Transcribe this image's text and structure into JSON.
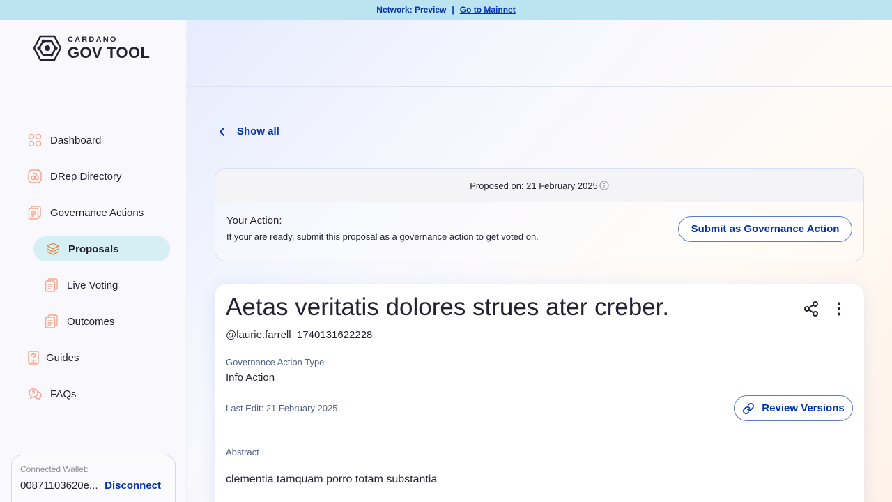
{
  "banner": {
    "network_text": "Network: Preview",
    "separator": "|",
    "mainnet_link": "Go to Mainnet"
  },
  "logo": {
    "small_text": "CARDANO",
    "big_text": "GOV TOOL"
  },
  "sidebar": {
    "items": [
      {
        "label": "Dashboard",
        "icon": "dashboard-icon"
      },
      {
        "label": "DRep Directory",
        "icon": "drep-directory-icon"
      },
      {
        "label": "Governance Actions",
        "icon": "governance-actions-icon"
      },
      {
        "label": "Proposals",
        "icon": "proposals-icon",
        "active": true
      },
      {
        "label": "Live Voting",
        "icon": "live-voting-icon"
      },
      {
        "label": "Outcomes",
        "icon": "outcomes-icon"
      },
      {
        "label": "Guides",
        "icon": "guides-icon"
      },
      {
        "label": "FAQs",
        "icon": "faqs-icon"
      }
    ]
  },
  "wallet": {
    "label": "Connected Wallet:",
    "address": "00871103620e...",
    "disconnect_label": "Disconnect"
  },
  "main": {
    "show_all_label": "Show all",
    "action_card": {
      "proposed_on": "Proposed on: 21 February 2025",
      "your_action_label": "Your Action:",
      "your_action_desc": "If your are ready, submit this proposal as a governance action to get voted on.",
      "submit_label": "Submit as Governance Action"
    },
    "proposal": {
      "title": "Aetas veritatis dolores strues ater creber.",
      "author": "@laurie.farrell_1740131622228",
      "type_label": "Governance Action Type",
      "type_value": "Info Action",
      "last_edit": "Last Edit: 21 February 2025",
      "review_label": "Review Versions",
      "abstract_label": "Abstract",
      "abstract_value": "clementia tamquam porro totam substantia"
    }
  },
  "colors": {
    "accent": "#0033ad",
    "banner_bg": "#bce3f0",
    "active_nav_bg": "#d5eff5",
    "nav_icon": "#f5a58a",
    "proposals_icon": "#e98a3c"
  }
}
